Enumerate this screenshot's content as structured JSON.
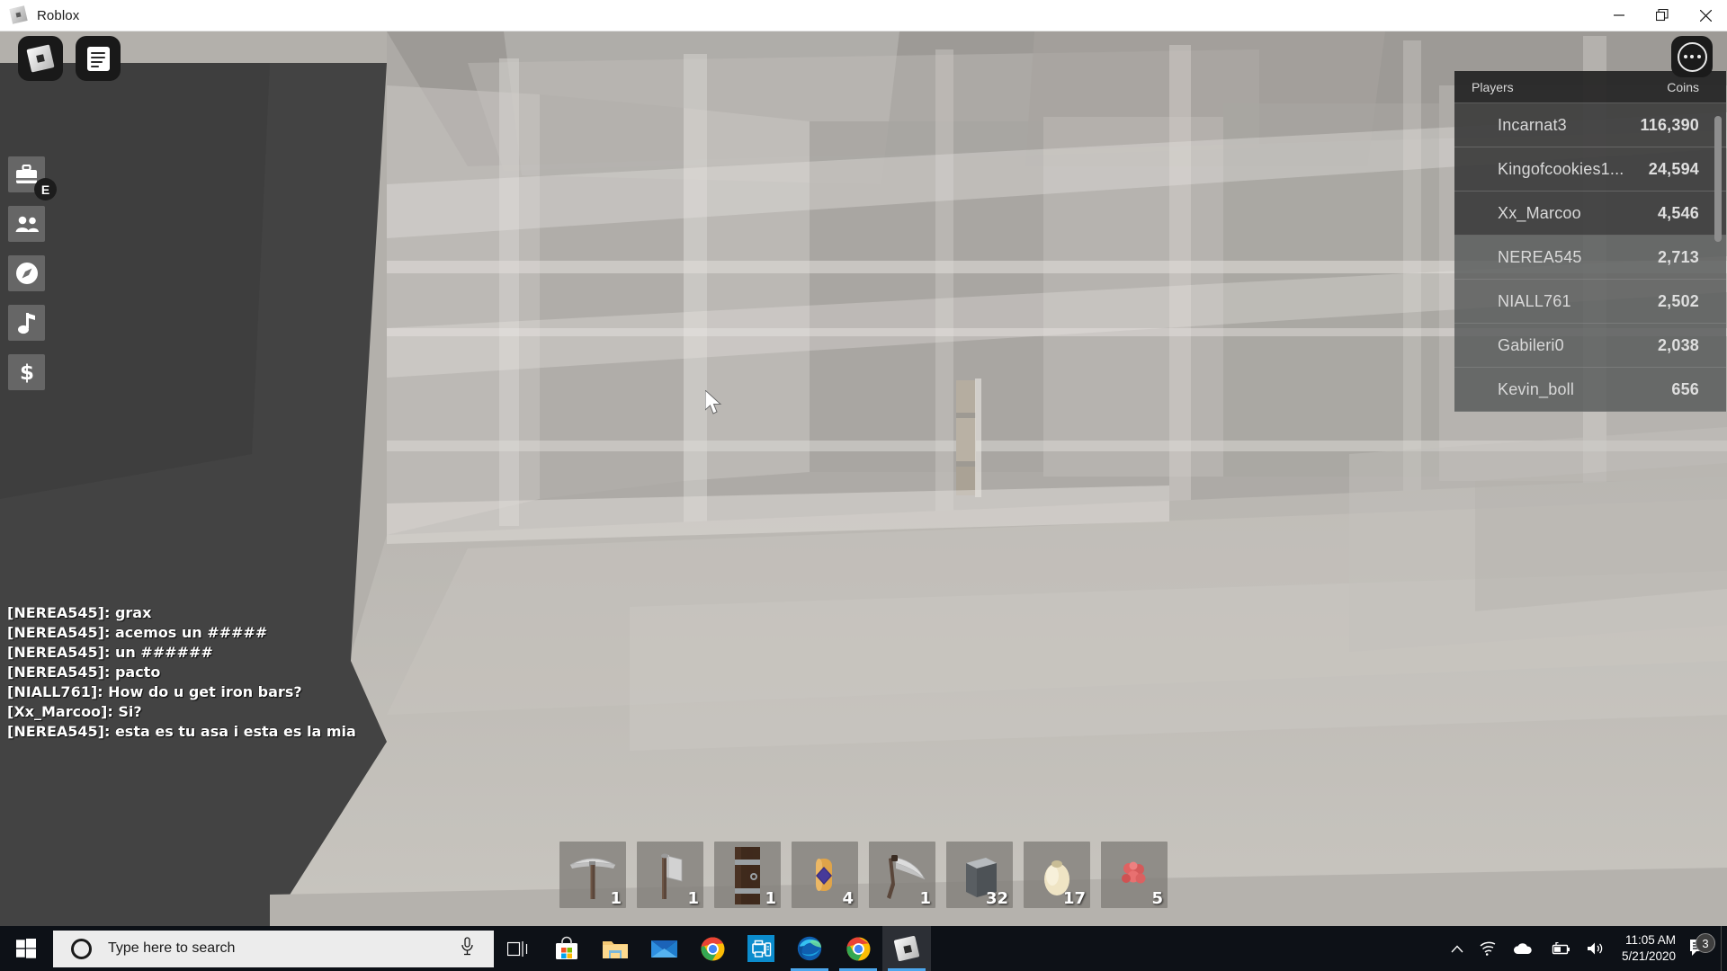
{
  "window": {
    "title": "Roblox",
    "icon": "roblox-logo-icon",
    "controls": {
      "minimize": "—",
      "restore": "❐",
      "close": "✕"
    }
  },
  "game": {
    "top_left_buttons": [
      {
        "name": "roblox-menu-button",
        "icon": "roblox-logo-icon"
      },
      {
        "name": "chat-toggle-button",
        "icon": "chat-document-icon"
      }
    ],
    "more_button": {
      "name": "more-options-button",
      "icon": "ellipsis-circle-icon"
    },
    "rail": [
      {
        "name": "backpack-button",
        "icon": "backpack-icon",
        "key": "E"
      },
      {
        "name": "friends-button",
        "icon": "people-icon"
      },
      {
        "name": "explore-button",
        "icon": "compass-icon"
      },
      {
        "name": "music-button",
        "icon": "music-note-icon"
      },
      {
        "name": "shop-button",
        "icon": "dollar-sign-icon"
      }
    ]
  },
  "leaderboard": {
    "header": {
      "players": "Players",
      "coins": "Coins"
    },
    "rows": [
      {
        "name": "Incarnat3",
        "coins": "116,390"
      },
      {
        "name": "Kingofcookies1...",
        "coins": "24,594"
      },
      {
        "name": "Xx_Marcoo",
        "coins": "4,546"
      },
      {
        "name": "NEREA545",
        "coins": "2,713"
      },
      {
        "name": "NIALL761",
        "coins": "2,502"
      },
      {
        "name": "Gabileri0",
        "coins": "2,038"
      },
      {
        "name": "Kevin_boll",
        "coins": "656"
      }
    ]
  },
  "chat": {
    "messages": [
      "[NEREA545]: grax",
      "[NEREA545]: acemos un #####",
      "[NEREA545]: un ######",
      "[NEREA545]: pacto",
      "[NIALL761]: How do u get iron bars?",
      "[Xx_Marcoo]: Si?",
      "[NEREA545]: esta es tu asa i esta es la mia"
    ]
  },
  "hotbar": {
    "slots": [
      {
        "item": "pickaxe",
        "qty": "1"
      },
      {
        "item": "axe",
        "qty": "1"
      },
      {
        "item": "wooden-door",
        "qty": "1"
      },
      {
        "item": "amulet-potion",
        "qty": "4"
      },
      {
        "item": "scythe",
        "qty": "1"
      },
      {
        "item": "stone-block",
        "qty": "32"
      },
      {
        "item": "egg",
        "qty": "17"
      },
      {
        "item": "berries",
        "qty": "5"
      }
    ]
  },
  "taskbar": {
    "start": "windows-start-icon",
    "search": {
      "placeholder": "Type here to search",
      "value": ""
    },
    "mic_icon": "microphone-icon",
    "apps": [
      {
        "name": "task-view-button",
        "icon": "task-view-icon",
        "active": false
      },
      {
        "name": "microsoft-store-button",
        "icon": "store-bag-icon",
        "active": false
      },
      {
        "name": "file-explorer-button",
        "icon": "folder-icon",
        "active": false
      },
      {
        "name": "mail-button",
        "icon": "envelope-icon",
        "active": false
      },
      {
        "name": "chrome-button",
        "icon": "chrome-icon",
        "active": false
      },
      {
        "name": "scanner-app-button",
        "icon": "printer-scanner-icon",
        "active": false
      },
      {
        "name": "edge-button",
        "icon": "edge-icon",
        "active": true
      },
      {
        "name": "chrome-window-button",
        "icon": "chrome-icon",
        "active": true
      },
      {
        "name": "roblox-window-button",
        "icon": "roblox-logo-icon",
        "active": true
      }
    ],
    "tray": [
      {
        "name": "show-hidden-icons-button",
        "icon": "chevron-up-icon"
      },
      {
        "name": "network-button",
        "icon": "wifi-icon"
      },
      {
        "name": "onedrive-button",
        "icon": "cloud-icon"
      },
      {
        "name": "battery-button",
        "icon": "battery-charging-icon"
      },
      {
        "name": "volume-button",
        "icon": "speaker-icon"
      }
    ],
    "clock": {
      "time": "11:05 AM",
      "date": "5/21/2020"
    },
    "notifications": {
      "icon": "notification-icon",
      "count": "3"
    }
  },
  "colors": {
    "accent": "#4ca6ec",
    "taskbar_bg": "#0d1117",
    "leaderboard_bg": "#545656",
    "titlebar_bg": "#ffffff"
  }
}
